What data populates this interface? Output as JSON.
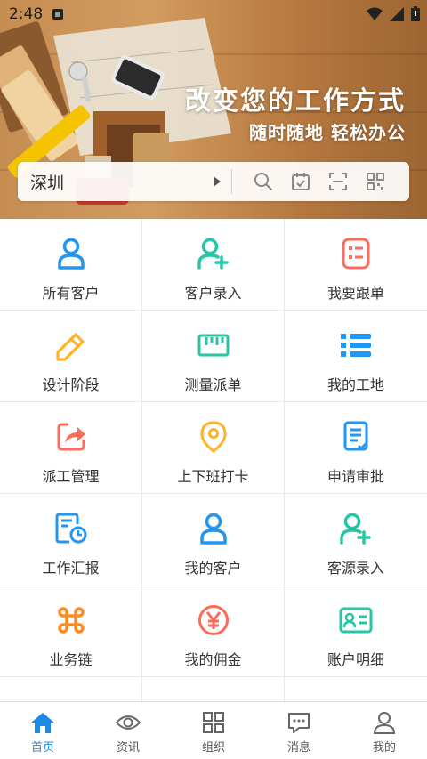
{
  "status_bar": {
    "time": "2:48"
  },
  "banner": {
    "headline": "改变您的工作方式",
    "subline": "随时随地 轻松办公"
  },
  "search": {
    "city": "深圳",
    "icons": [
      "search-icon",
      "calendar-icon",
      "scan-icon",
      "qr-code-icon"
    ]
  },
  "grid": {
    "items": [
      {
        "label": "所有客户",
        "icon": "user-icon",
        "color": "#2196f3"
      },
      {
        "label": "客户录入",
        "icon": "user-add-icon",
        "color": "#26c6a6"
      },
      {
        "label": "我要跟单",
        "icon": "list-card-icon",
        "color": "#ff6b5b"
      },
      {
        "label": "设计阶段",
        "icon": "pencil-icon",
        "color": "#ffb22e"
      },
      {
        "label": "测量派单",
        "icon": "ruler-icon",
        "color": "#26c6a6"
      },
      {
        "label": "我的工地",
        "icon": "bullet-list-icon",
        "color": "#2196f3"
      },
      {
        "label": "派工管理",
        "icon": "share-icon",
        "color": "#ff6b5b"
      },
      {
        "label": "上下班打卡",
        "icon": "location-pin-icon",
        "color": "#ffb22e"
      },
      {
        "label": "申请审批",
        "icon": "document-icon",
        "color": "#2196f3"
      },
      {
        "label": "工作汇报",
        "icon": "report-clock-icon",
        "color": "#2196f3"
      },
      {
        "label": "我的客户",
        "icon": "user-icon",
        "color": "#2196f3"
      },
      {
        "label": "客源录入",
        "icon": "user-add-icon",
        "color": "#26c6a6"
      },
      {
        "label": "业务链",
        "icon": "command-icon",
        "color": "#ff8a1f"
      },
      {
        "label": "我的佣金",
        "icon": "yen-coin-icon",
        "color": "#ff6b5b"
      },
      {
        "label": "账户明细",
        "icon": "id-card-icon",
        "color": "#26c6a6"
      }
    ]
  },
  "bottom_nav": {
    "items": [
      {
        "label": "首页",
        "icon": "home-icon",
        "active": true
      },
      {
        "label": "资讯",
        "icon": "eye-icon",
        "active": false
      },
      {
        "label": "组织",
        "icon": "grid-icon",
        "active": false
      },
      {
        "label": "消息",
        "icon": "chat-icon",
        "active": false
      },
      {
        "label": "我的",
        "icon": "profile-icon",
        "active": false
      }
    ],
    "active_color": "#1e88e5",
    "inactive_color": "#666666"
  }
}
